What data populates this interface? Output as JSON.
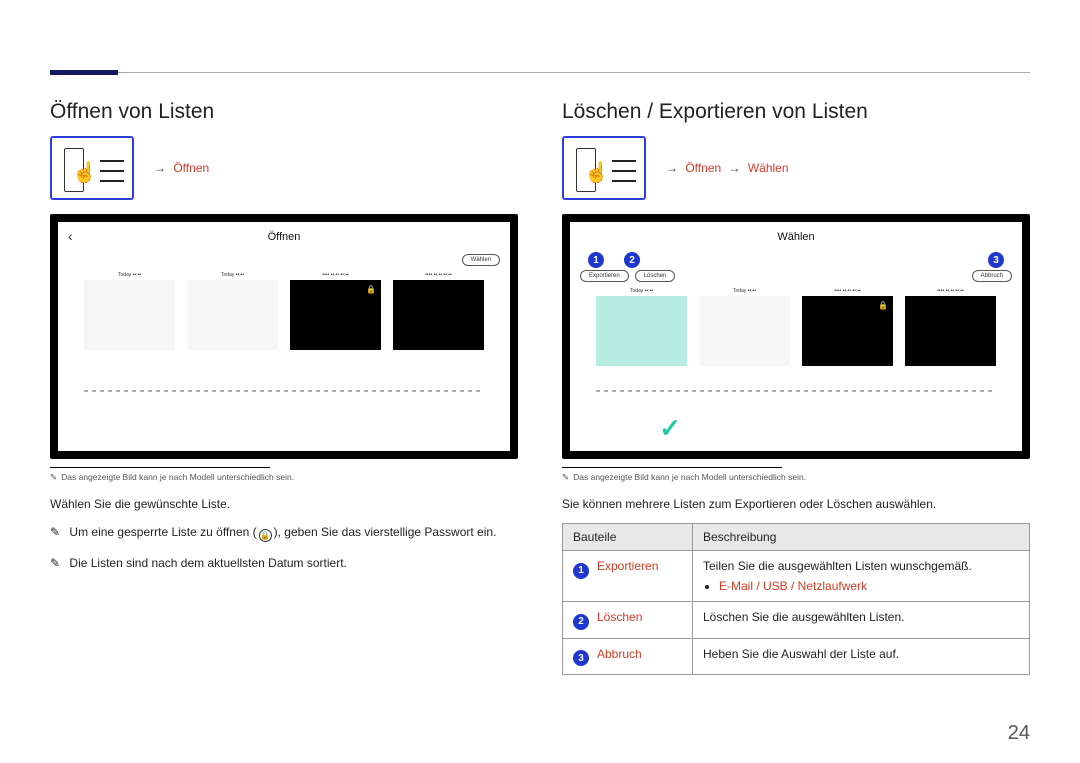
{
  "page_number": "24",
  "left": {
    "heading": "Öffnen von Listen",
    "path": [
      "Öffnen"
    ],
    "device_title": "Öffnen",
    "pill": "Wählen",
    "slot_labels": [
      "Today ••:••",
      "Today ••:••",
      "••••.••.•• ••:••",
      "••••.••.•• ••:••"
    ],
    "disclaimer": "Das angezeigte Bild kann je nach Modell unterschiedlich sein.",
    "lead": "Wählen Sie die gewünschte Liste.",
    "bullets": [
      "Um eine gesperrte Liste zu öffnen ( 🔒 ), geben Sie das vierstellige Passwort ein.",
      "Die Listen sind nach dem aktuellsten Datum sortiert."
    ]
  },
  "right": {
    "heading": "Löschen / Exportieren von Listen",
    "path": [
      "Öffnen",
      "Wählen"
    ],
    "device_title": "Wählen",
    "pill_left1": "Exportieren",
    "pill_left2": "Löschen",
    "pill_right": "Abbruch",
    "slot_labels": [
      "Today ••:••",
      "Today ••:••",
      "••••.••.•• ••:••",
      "••••.••.•• ••:••"
    ],
    "disclaimer": "Das angezeigte Bild kann je nach Modell unterschiedlich sein.",
    "lead": "Sie können mehrere Listen zum Exportieren oder Löschen auswählen.",
    "table": {
      "col1": "Bauteile",
      "col2": "Beschreibung",
      "rows": [
        {
          "num": "1",
          "name": "Exportieren",
          "desc": "Teilen Sie die ausgewählten Listen wunschgemäß.",
          "options": "E-Mail / USB / Netzlaufwerk"
        },
        {
          "num": "2",
          "name": "Löschen",
          "desc": "Löschen Sie die ausgewählten Listen."
        },
        {
          "num": "3",
          "name": "Abbruch",
          "desc": "Heben Sie die Auswahl der Liste auf."
        }
      ]
    }
  }
}
